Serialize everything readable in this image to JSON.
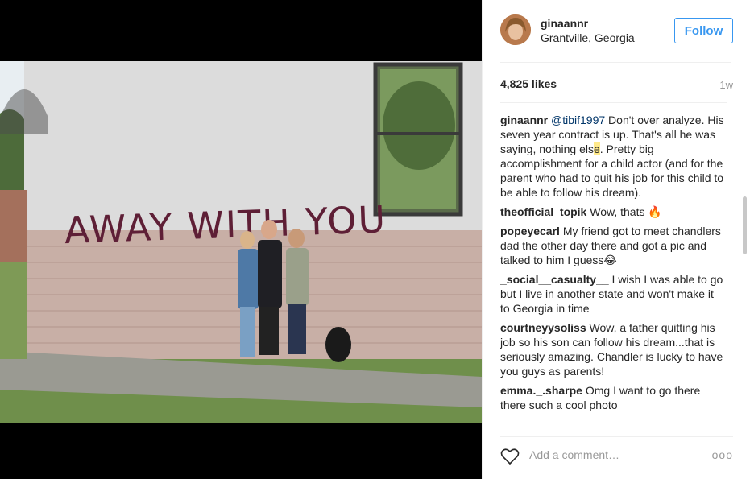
{
  "post": {
    "username": "ginaannr",
    "location": "Grantville, Georgia",
    "follow_label": "Follow",
    "likes": "4,825 likes",
    "time": "1w",
    "photo_text": "AWAY WITH YOU"
  },
  "comments": [
    {
      "user": "ginaannr",
      "mention": "@tibif1997",
      "pre": " Don't over analyze. His seven year contract is up. That's all he was saying, nothing els",
      "hl": "e",
      "post": ". Pretty big accomplishment for a child actor (and for the parent who had to quit his job for this child to be able to follow his dream)."
    },
    {
      "user": "theofficial_topik",
      "text": " Wow, thats 🔥"
    },
    {
      "user": "popeyecarl",
      "text": " My friend got to meet chandlers dad the other day there and got a pic and talked to him I guess😂"
    },
    {
      "user": "_social__casualty__",
      "text": " I wish I was able to go but I live in another state and won't make it to Georgia in time"
    },
    {
      "user": "courtneyysoliss",
      "text": " Wow, a father quitting his job so his son can follow his dream...that is seriously amazing. Chandler is lucky to have you guys as parents!"
    },
    {
      "user": "emma._.sharpe",
      "text": " Omg I want to go there there such a cool photo"
    }
  ],
  "footer": {
    "add_comment_placeholder": "Add a comment…",
    "more_label": "ooo"
  },
  "icons": {
    "like": "heart-icon",
    "more": "more-options-icon"
  },
  "colors": {
    "link_blue": "#3897f0",
    "mention_blue": "#003569",
    "muted": "#999999"
  }
}
